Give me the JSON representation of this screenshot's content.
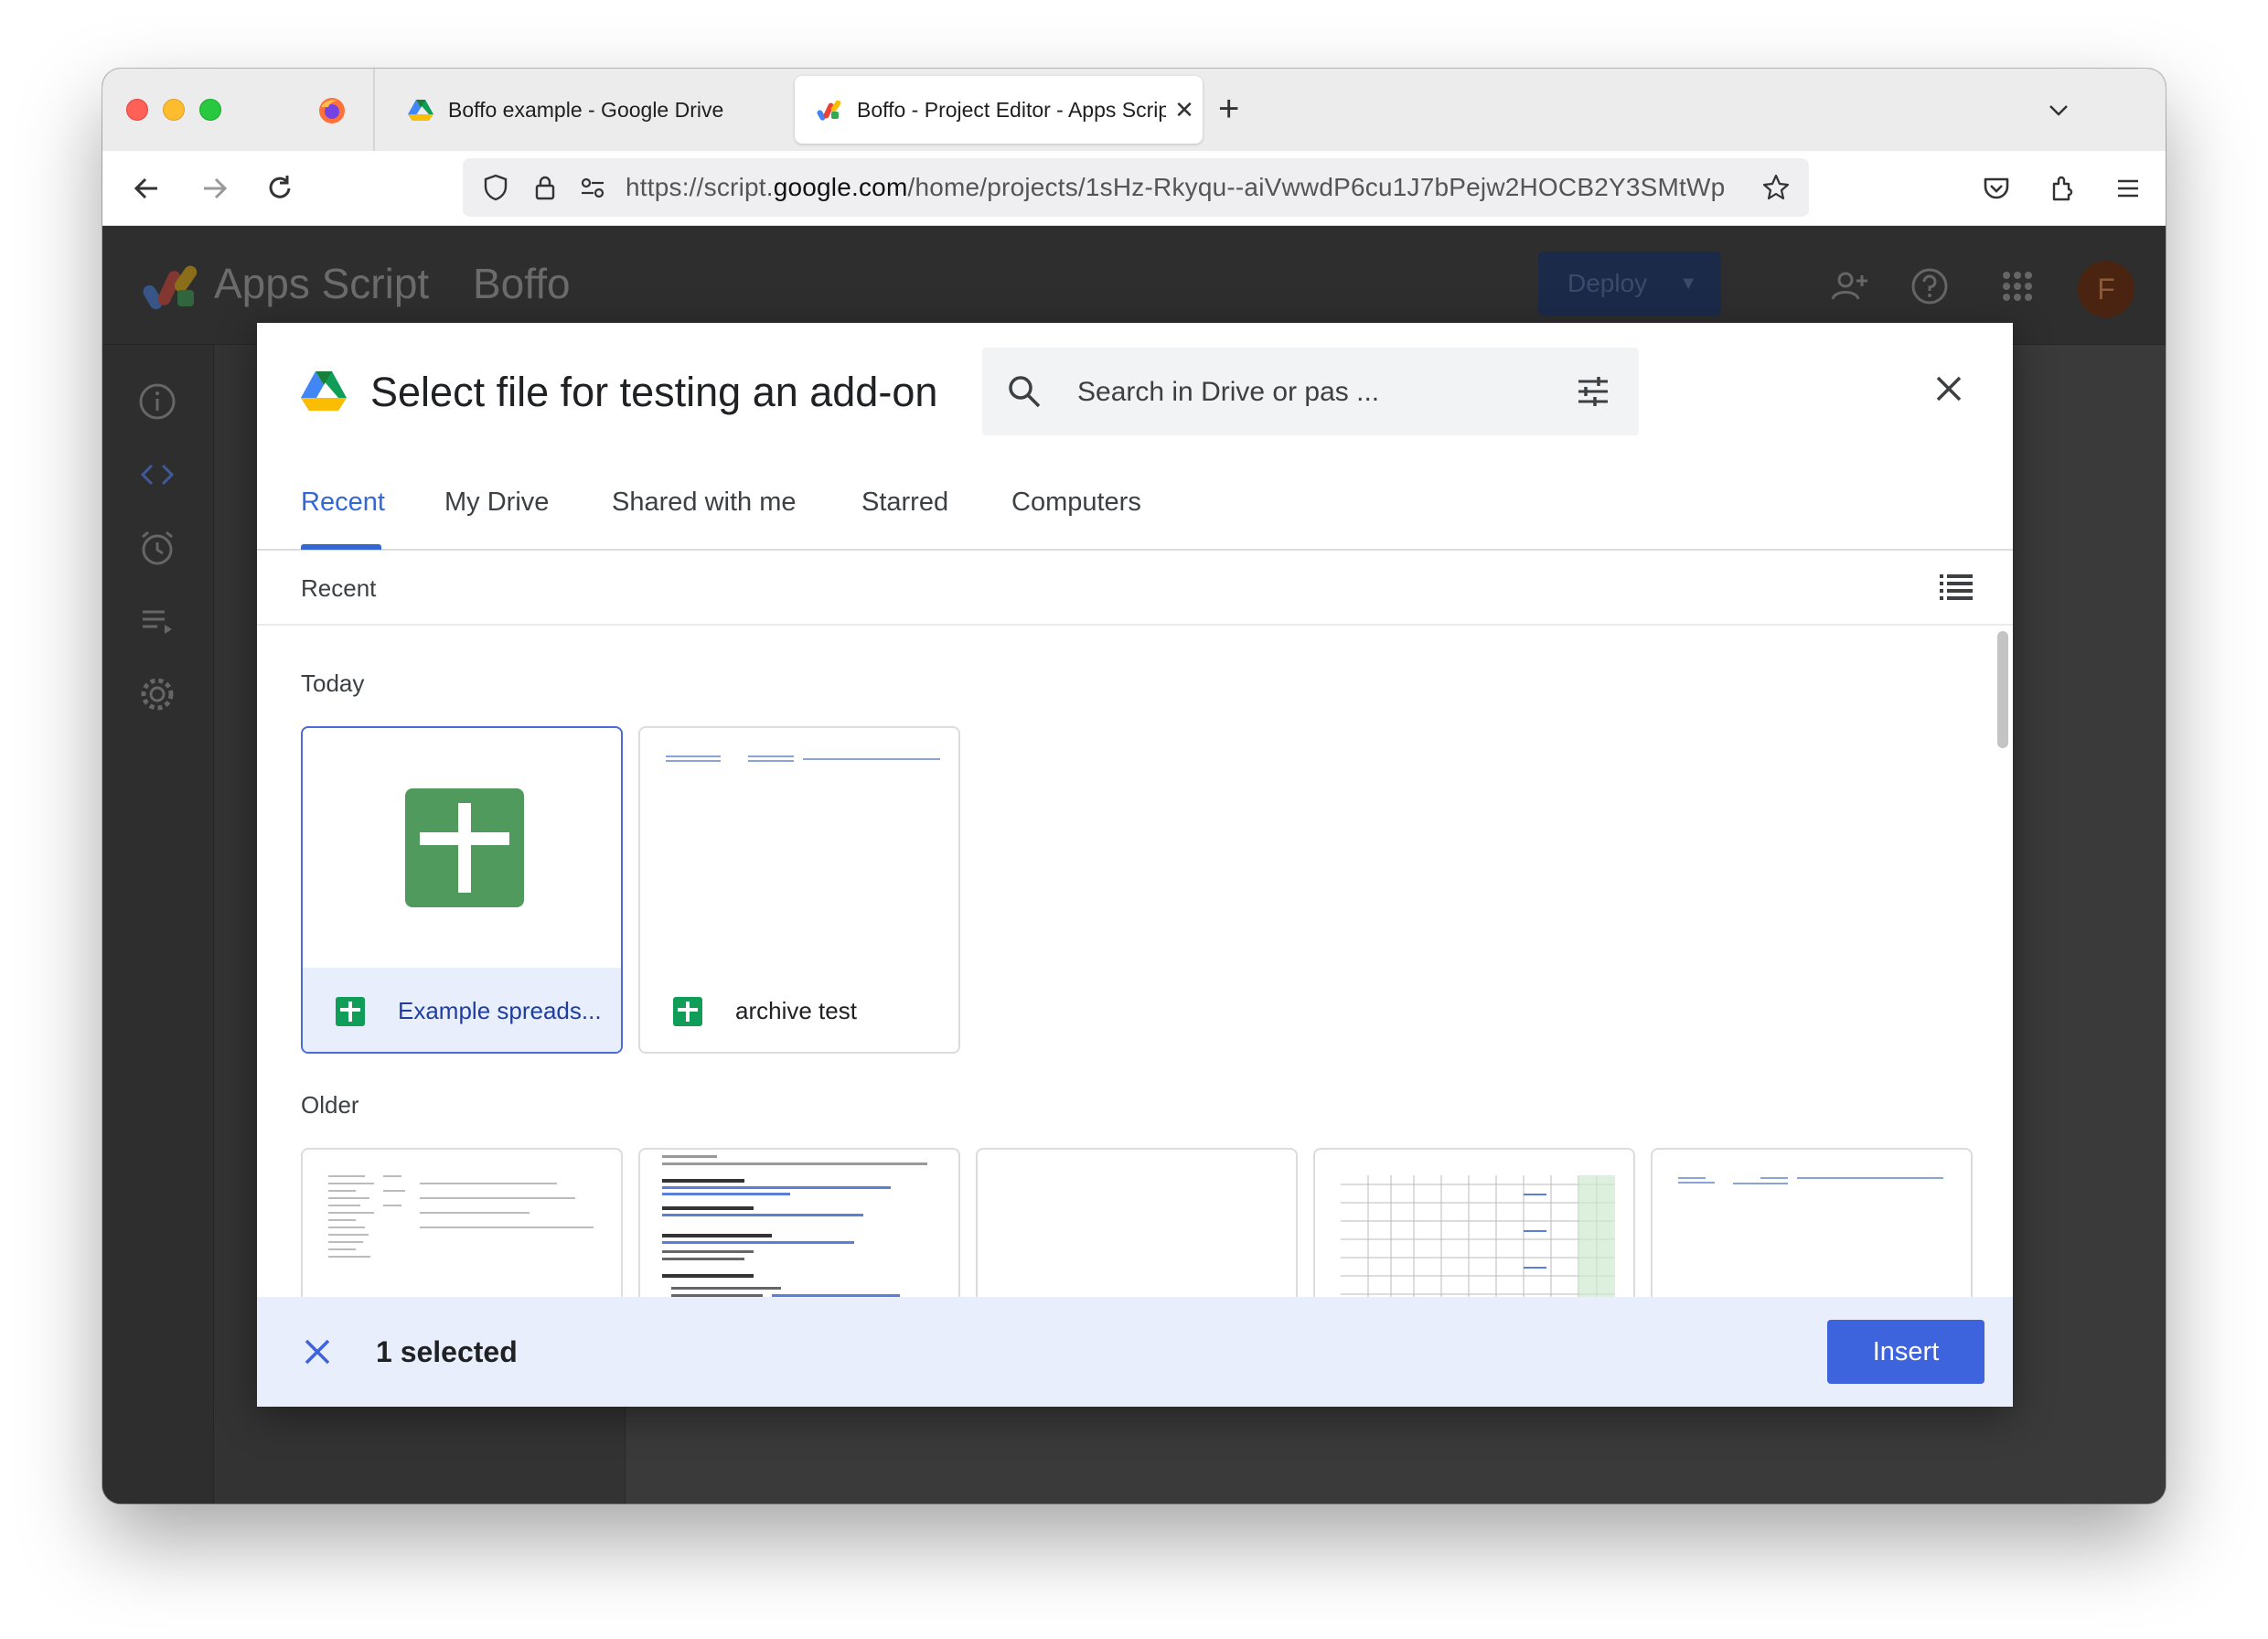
{
  "browser": {
    "tabs": [
      {
        "label": "Boffo example - Google Drive",
        "close": "✕"
      },
      {
        "label": "Boffo - Project Editor - Apps Script",
        "close": "✕"
      }
    ],
    "new_tab": "+",
    "url": {
      "prefix": "https://script.",
      "domain": "google.com",
      "path": "/home/projects/1sHz-Rkyqu--aiVwwdP6cu1J7bPejw2HOCB2Y3SMtWp"
    }
  },
  "app": {
    "name": "Apps Script",
    "project": "Boffo",
    "deploy_label": "Deploy",
    "avatar_initial": "F"
  },
  "dialog": {
    "title": "Select file for testing an add-on",
    "search_placeholder": "Search in Drive or pas ...",
    "tabs": [
      "Recent",
      "My Drive",
      "Shared with me",
      "Starred",
      "Computers"
    ],
    "active_tab": "Recent",
    "section_label": "Recent",
    "groups": {
      "today": "Today",
      "older": "Older"
    },
    "files_today": [
      {
        "name": "Example spreads...",
        "selected": true
      },
      {
        "name": "archive test",
        "selected": false
      }
    ],
    "selected_text": "1 selected",
    "insert_label": "Insert"
  },
  "colors": {
    "accent": "#3367d6",
    "insert": "#3d63dd",
    "sheets_green": "#0f9d58",
    "selection_bg": "#e8eefc"
  }
}
